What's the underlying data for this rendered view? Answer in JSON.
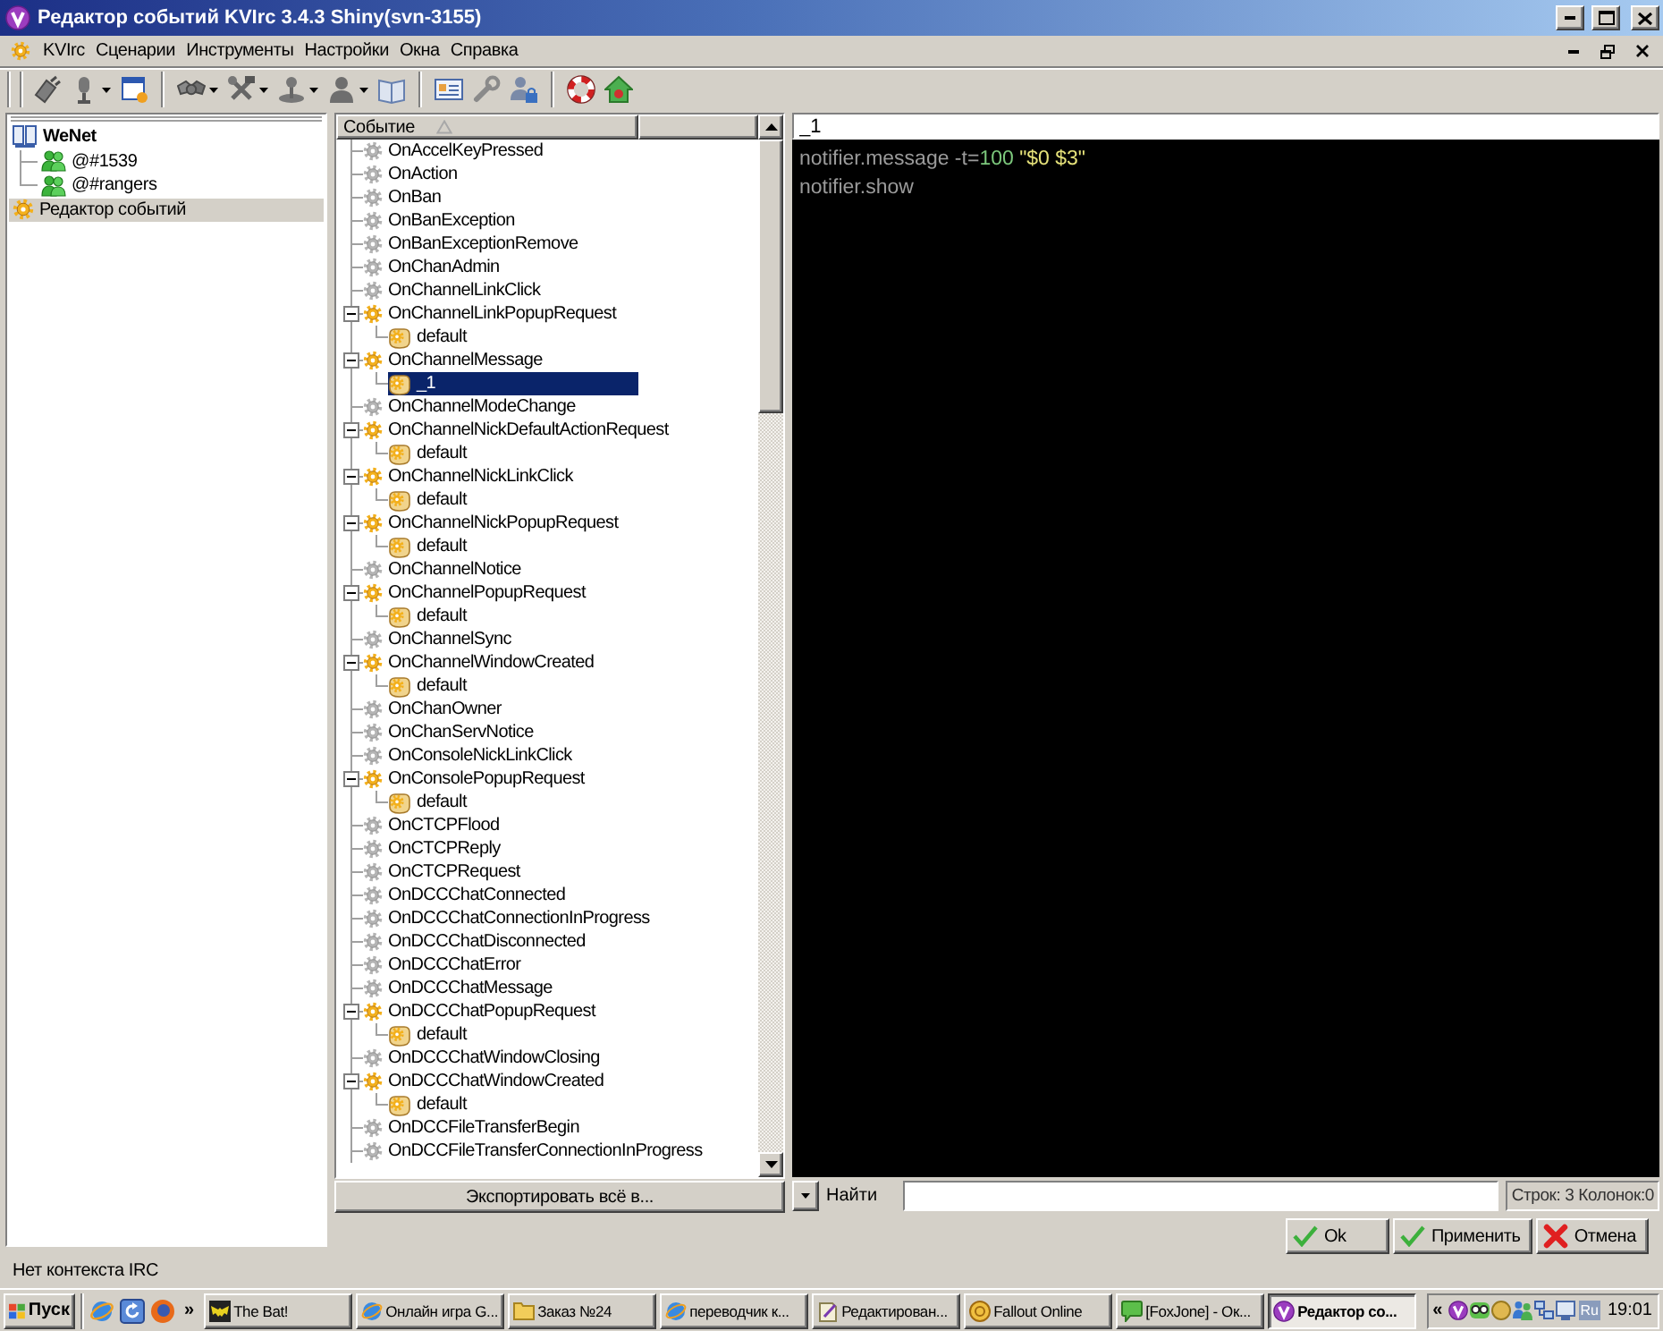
{
  "window": {
    "title": "Редактор событий KVIrc 3.4.3 Shiny(svn-3155)"
  },
  "menu": [
    "KVIrc",
    "Сценарии",
    "Инструменты",
    "Настройки",
    "Окна",
    "Справка"
  ],
  "window_list": [
    {
      "kind": "network",
      "label": "WeNet",
      "selected": false,
      "children": [
        {
          "kind": "channel",
          "label": "@#1539",
          "selected": false
        },
        {
          "kind": "channel",
          "label": "@#rangers",
          "selected": false
        }
      ]
    },
    {
      "kind": "tool",
      "label": "Редактор событий",
      "selected": true
    }
  ],
  "event_tree": {
    "header": "Событие",
    "items": [
      {
        "label": "OnAccelKeyPressed",
        "selected": false
      },
      {
        "label": "OnAction",
        "selected": false
      },
      {
        "label": "OnBan",
        "selected": false
      },
      {
        "label": "OnBanException",
        "selected": false
      },
      {
        "label": "OnBanExceptionRemove",
        "selected": false
      },
      {
        "label": "OnChanAdmin",
        "selected": false
      },
      {
        "label": "OnChannelLinkClick",
        "selected": false
      },
      {
        "label": "OnChannelLinkPopupRequest",
        "selected": false,
        "expanded": true,
        "children": [
          {
            "label": "default",
            "selected": false
          }
        ]
      },
      {
        "label": "OnChannelMessage",
        "selected": false,
        "expanded": true,
        "children": [
          {
            "label": "_1",
            "selected": true
          }
        ]
      },
      {
        "label": "OnChannelModeChange",
        "selected": false
      },
      {
        "label": "OnChannelNickDefaultActionRequest",
        "selected": false,
        "expanded": true,
        "children": [
          {
            "label": "default",
            "selected": false
          }
        ]
      },
      {
        "label": "OnChannelNickLinkClick",
        "selected": false,
        "expanded": true,
        "children": [
          {
            "label": "default",
            "selected": false
          }
        ]
      },
      {
        "label": "OnChannelNickPopupRequest",
        "selected": false,
        "expanded": true,
        "children": [
          {
            "label": "default",
            "selected": false
          }
        ]
      },
      {
        "label": "OnChannelNotice",
        "selected": false
      },
      {
        "label": "OnChannelPopupRequest",
        "selected": false,
        "expanded": true,
        "children": [
          {
            "label": "default",
            "selected": false
          }
        ]
      },
      {
        "label": "OnChannelSync",
        "selected": false
      },
      {
        "label": "OnChannelWindowCreated",
        "selected": false,
        "expanded": true,
        "children": [
          {
            "label": "default",
            "selected": false
          }
        ]
      },
      {
        "label": "OnChanOwner",
        "selected": false
      },
      {
        "label": "OnChanServNotice",
        "selected": false
      },
      {
        "label": "OnConsoleNickLinkClick",
        "selected": false
      },
      {
        "label": "OnConsolePopupRequest",
        "selected": false,
        "expanded": true,
        "children": [
          {
            "label": "default",
            "selected": false
          }
        ]
      },
      {
        "label": "OnCTCPFlood",
        "selected": false
      },
      {
        "label": "OnCTCPReply",
        "selected": false
      },
      {
        "label": "OnCTCPRequest",
        "selected": false
      },
      {
        "label": "OnDCCChatConnected",
        "selected": false
      },
      {
        "label": "OnDCCChatConnectionInProgress",
        "selected": false
      },
      {
        "label": "OnDCCChatDisconnected",
        "selected": false
      },
      {
        "label": "OnDCCChatError",
        "selected": false
      },
      {
        "label": "OnDCCChatMessage",
        "selected": false
      },
      {
        "label": "OnDCCChatPopupRequest",
        "selected": false,
        "expanded": true,
        "children": [
          {
            "label": "default",
            "selected": false
          }
        ]
      },
      {
        "label": "OnDCCChatWindowClosing",
        "selected": false
      },
      {
        "label": "OnDCCChatWindowCreated",
        "selected": false,
        "expanded": true,
        "children": [
          {
            "label": "default",
            "selected": false
          }
        ]
      },
      {
        "label": "OnDCCFileTransferBegin",
        "selected": false
      },
      {
        "label": "OnDCCFileTransferConnectionInProgress",
        "selected": false
      }
    ],
    "export_button": "Экспортировать всё в..."
  },
  "handler": {
    "name": "_1",
    "lines": [
      {
        "tokens": [
          {
            "text": "notifier.message -t=",
            "kind": "plain"
          },
          {
            "text": "100",
            "kind": "number"
          },
          {
            "text": " \"$0 $3\"",
            "kind": "string"
          }
        ]
      },
      {
        "tokens": [
          {
            "text": "notifier.show",
            "kind": "plain"
          }
        ]
      }
    ]
  },
  "find_bar": {
    "label": "Найти",
    "cursor_info": "Строк: 3 Колонок:0"
  },
  "buttons": [
    {
      "label": "Ok",
      "kind": "accept"
    },
    {
      "label": "Применить",
      "kind": "accept"
    },
    {
      "label": "Отмена",
      "kind": "cancel"
    }
  ],
  "status_bar": "Нет контекста IRC",
  "taskbar": {
    "start": "Пуск",
    "quick_launch_more": "»",
    "tasks": [
      {
        "label": "The Bat!",
        "kind": "mail",
        "selected": false
      },
      {
        "label": "Онлайн игра G...",
        "kind": "browser",
        "selected": false
      },
      {
        "label": "Заказ №24",
        "kind": "folder",
        "selected": false
      },
      {
        "label": "переводчик к...",
        "kind": "browser",
        "selected": false
      },
      {
        "label": "Редактирован...",
        "kind": "document",
        "selected": false
      },
      {
        "label": "Fallout Online",
        "kind": "game",
        "selected": false
      },
      {
        "label": "[FoxJone] - Ок...",
        "kind": "chat",
        "selected": false
      },
      {
        "label": "Редактор со...",
        "kind": "app",
        "selected": true
      }
    ],
    "tray_expand": "«",
    "language": "Ru",
    "clock": "19:01"
  }
}
